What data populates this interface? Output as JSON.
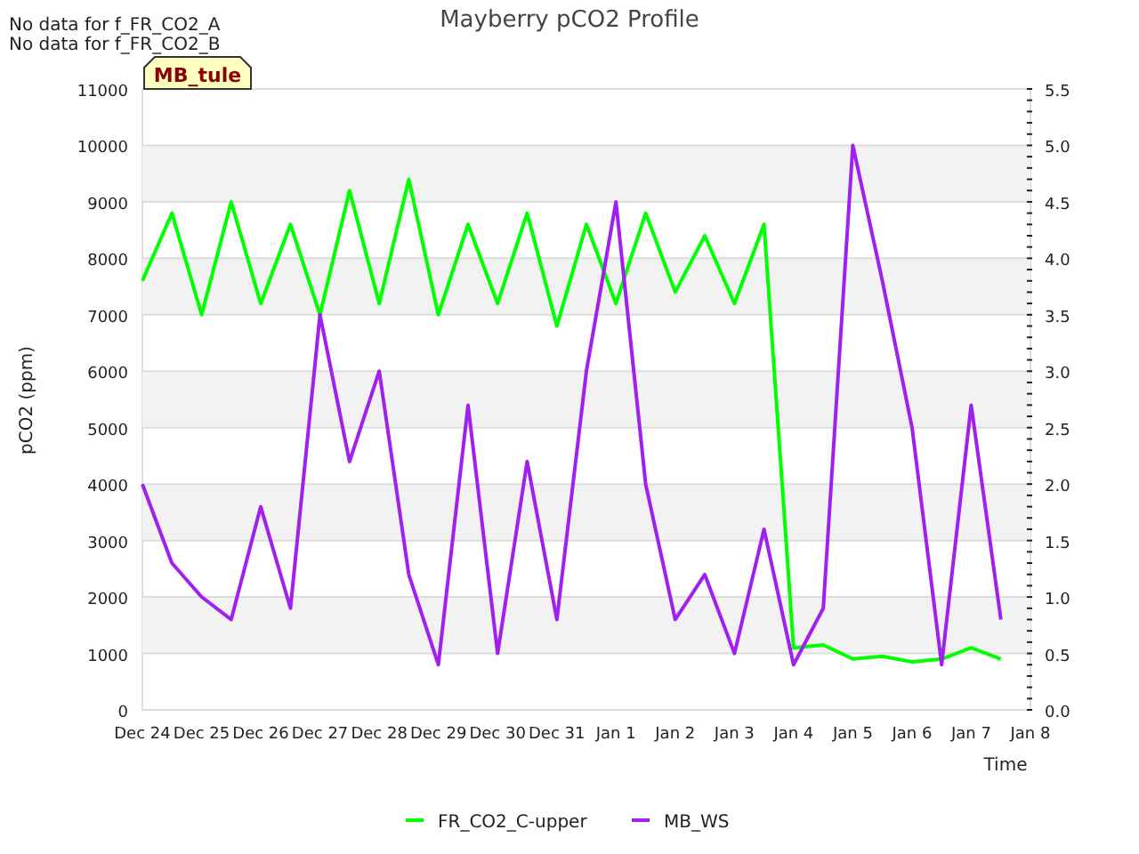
{
  "notices": [
    "No data for f_FR_CO2_A",
    "No data for f_FR_CO2_B"
  ],
  "site_label": "MB_tule",
  "chart_data": {
    "type": "line",
    "title": "Mayberry pCO2 Profile",
    "xlabel": "Time",
    "ylabel": "pCO2 (ppm)",
    "categories": [
      "Dec 24",
      null,
      "Dec 25",
      null,
      "Dec 26",
      null,
      "Dec 27",
      null,
      "Dec 28",
      null,
      "Dec 29",
      null,
      "Dec 30",
      null,
      "Dec 31",
      null,
      "Jan 1",
      null,
      "Jan 2",
      null,
      "Jan 3",
      null,
      "Jan 4",
      null,
      "Jan 5",
      null,
      "Jan 6",
      null,
      "Jan 7",
      null,
      "Jan 8"
    ],
    "ylim": [
      0,
      11000
    ],
    "grid": true,
    "legend": true,
    "yticks": [
      0,
      1000,
      2000,
      3000,
      4000,
      5000,
      6000,
      7000,
      8000,
      9000,
      10000,
      11000
    ],
    "y2lim": [
      0,
      5.5
    ],
    "y2ticks": [
      {
        "value": 0,
        "label": "0.0"
      },
      {
        "value": 0.5,
        "label": "0.5"
      },
      {
        "value": 1,
        "label": "1.0"
      },
      {
        "value": 1.5,
        "label": "1.5"
      },
      {
        "value": 2,
        "label": "2.0"
      },
      {
        "value": 2.5,
        "label": "2.5"
      },
      {
        "value": 3,
        "label": "3.0"
      },
      {
        "value": 3.5,
        "label": "3.5"
      },
      {
        "value": 4,
        "label": "4.0"
      },
      {
        "value": 4.5,
        "label": "4.5"
      },
      {
        "value": 5,
        "label": "5.0"
      },
      {
        "value": 5.5,
        "label": "5.5"
      }
    ],
    "series": [
      {
        "name": "FR_CO2_C-upper",
        "color": "#00ff00",
        "values": [
          7600,
          8800,
          7000,
          9000,
          7200,
          8600,
          7000,
          9200,
          7200,
          9400,
          7000,
          8600,
          7200,
          8800,
          6800,
          8600,
          7200,
          8800,
          7400,
          8400,
          7200,
          8600,
          1100,
          1150,
          900,
          950,
          850,
          900,
          1100,
          900,
          null
        ]
      },
      {
        "name": "MB_WS",
        "color": "#a020f0",
        "axis": "y2",
        "values": [
          2,
          1.3,
          1,
          0.8,
          1.8,
          0.9,
          3.5,
          2.2,
          3,
          1.2,
          0.4,
          2.7,
          0.5,
          2.2,
          0.8,
          3,
          4.5,
          2,
          0.8,
          1.2,
          0.5,
          1.6,
          0.4,
          0.9,
          5,
          3.8,
          2.5,
          0.4,
          2.7,
          0.8,
          null
        ]
      }
    ]
  }
}
